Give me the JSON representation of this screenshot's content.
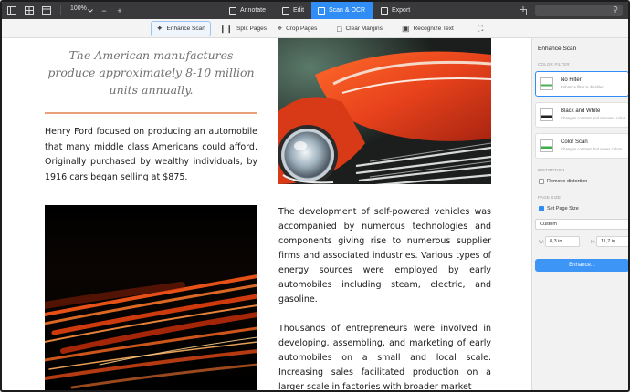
{
  "toolbar": {
    "zoom": "100%",
    "zoom_out": "−",
    "zoom_in": "+",
    "tabs": [
      {
        "label": "Annotate"
      },
      {
        "label": "Edit"
      },
      {
        "label": "Scan & OCR"
      },
      {
        "label": "Export"
      }
    ]
  },
  "subtoolbar": {
    "items": [
      {
        "label": "Enhance Scan"
      },
      {
        "label": "Split Pages"
      },
      {
        "label": "Crop Pages"
      },
      {
        "label": "Clear Margins"
      },
      {
        "label": "Recognize Text"
      }
    ]
  },
  "document": {
    "quote": "The American manufactures produce approximately 8-10 million units annually.",
    "paragraph1": "Henry Ford focused on producing an automobile that many middle class Americans could afford. Originally purchased by wealthy individuals, by 1916 cars began selling at $875.",
    "paragraph2": "The development of self-powered vehicles was accompanied by numerous technologies and components giving rise to numerous supplier firms and associated industries. Various types of energy sources were employed by early automobiles including steam, electric, and gasoline.",
    "paragraph3": "Thousands of entrepreneurs were involved in developing, assembling, and marketing of early automobiles on a small and local scale. Increasing sales facilitated production on a larger scale in factories with broader market"
  },
  "panel": {
    "title": "Enhance Scan",
    "color_filter_heading": "COLOR FILTER",
    "filters": [
      {
        "title": "No Filter",
        "desc": "Enhance filter is disabled"
      },
      {
        "title": "Black and White",
        "desc": "Changes contrast and removes color"
      },
      {
        "title": "Color Scan",
        "desc": "Changes contrast, but saves colors"
      }
    ],
    "distortion_heading": "DISTORTION",
    "remove_distortion": "Remove distortion",
    "page_size_heading": "PAGE SIZE",
    "set_page_size": "Set Page Size",
    "page_size_option": "Custom",
    "width_label": "W:",
    "width_value": "8,3 in",
    "height_label": "H:",
    "height_value": "11,7 in",
    "enhance_button": "Enhance..."
  },
  "colors": {
    "accent": "#2f8df5",
    "toolbar_bg": "#3a3a3c",
    "rule": "#e8a07a"
  }
}
